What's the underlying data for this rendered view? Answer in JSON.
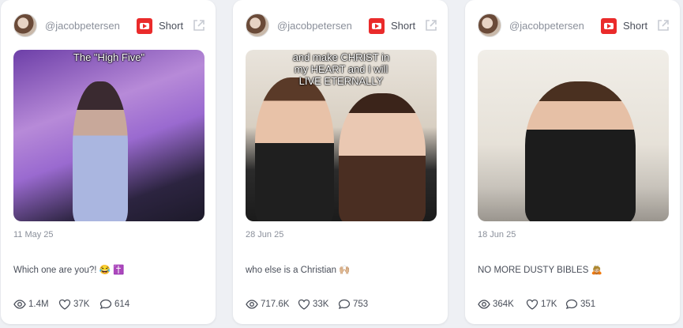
{
  "cards": [
    {
      "username": "@jacobpetersen",
      "type_label": "Short",
      "overlay_text": "The \"High Five\"",
      "date": "11 May 25",
      "description": "Which one are you?! 😂 ✝️",
      "stats": {
        "views": "1.4M",
        "likes": "37K",
        "comments": "614"
      }
    },
    {
      "username": "@jacobpetersen",
      "type_label": "Short",
      "overlay_text": "and make CHRIST in my HEART and I will LIVE ETERNALLY",
      "date": "28 Jun 25",
      "description": "who else is a Christian 🙌🏼",
      "stats": {
        "views": "717.6K",
        "likes": "33K",
        "comments": "753"
      }
    },
    {
      "username": "@jacobpetersen",
      "type_label": "Short",
      "overlay_text": "",
      "date": "18 Jun 25",
      "description": "NO MORE DUSTY BIBLES 🙇🏼",
      "stats": {
        "views": "364K",
        "likes": "17K",
        "comments": "351"
      }
    }
  ],
  "colors": {
    "youtube_red": "#ea2b2b",
    "muted": "#8a8f9a",
    "text": "#4a4f5a",
    "page_bg": "#eef0f4"
  }
}
